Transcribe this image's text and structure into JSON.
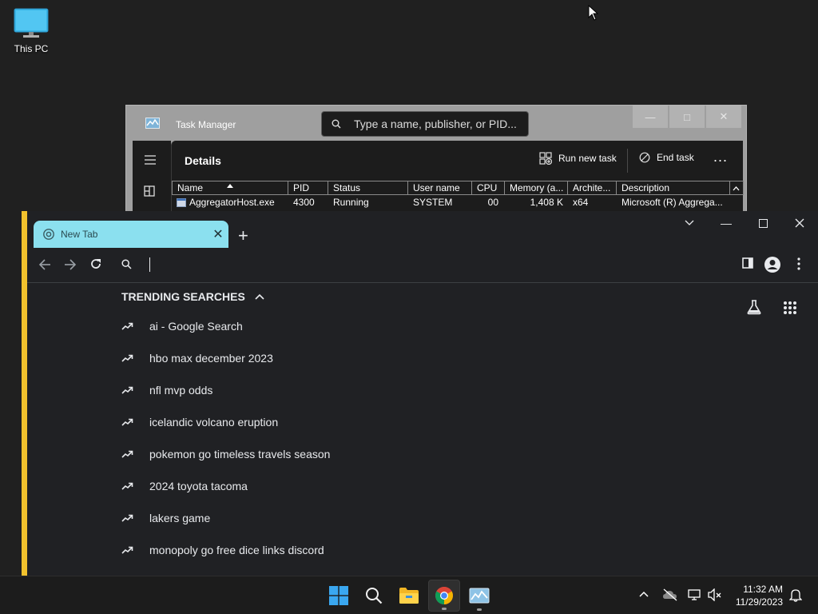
{
  "desktop": {
    "icons": [
      {
        "label": "This PC",
        "icon": "monitor-icon"
      }
    ]
  },
  "task_manager": {
    "title": "Task Manager",
    "search_placeholder": "Type a name, publisher, or PID...",
    "page_title": "Details",
    "run_new_task_label": "Run new task",
    "end_task_label": "End task",
    "more_label": "...",
    "columns": [
      "Name",
      "PID",
      "Status",
      "User name",
      "CPU",
      "Memory (a...",
      "Archite...",
      "Description"
    ],
    "rows": [
      [
        "AggregatorHost.exe",
        "4300",
        "Running",
        "SYSTEM",
        "00",
        "1,408 K",
        "x64",
        "Microsoft (R) Aggrega..."
      ]
    ]
  },
  "chrome": {
    "tab_title": "New Tab",
    "trending_header": "TRENDING SEARCHES",
    "suggestions": [
      "ai - Google Search",
      "hbo max december 2023",
      "nfl mvp odds",
      "icelandic volcano eruption",
      "pokemon go timeless travels season",
      "2024 toyota tacoma",
      "lakers game",
      "monopoly go free dice links discord"
    ]
  },
  "taskbar": {
    "time": "11:32 AM",
    "date": "11/29/2023"
  },
  "colors": {
    "tab_bg": "#8be0ef",
    "chrome_border": "#f2c22d",
    "desktop_bg": "#202020"
  }
}
